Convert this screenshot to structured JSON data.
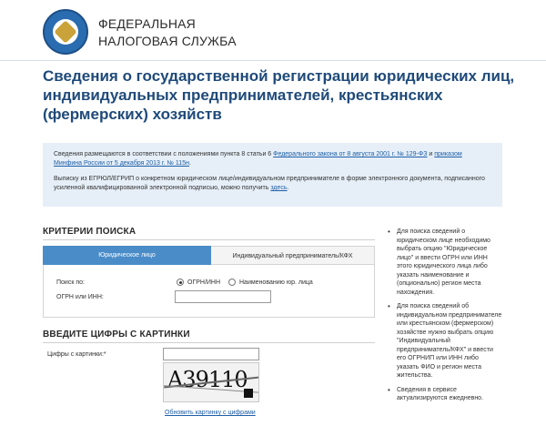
{
  "header": {
    "brand_line1": "ФЕДЕРАЛЬНАЯ",
    "brand_line2": "НАЛОГОВАЯ СЛУЖБА"
  },
  "page": {
    "title": "Сведения о государственной регистрации юридических лиц, индивидуальных предпринимателей, крестьянских (фермерских) хозяйств"
  },
  "info": {
    "p1_text": "Сведения размещаются в соответствии с положениями пункта 8 статьи 6 ",
    "p1_link1": "Федерального закона от 8 августа 2001 г. № 129-ФЗ",
    "p1_mid": " и ",
    "p1_link2": "приказом Минфина России от 5 декабря 2013 г. № 115н",
    "p1_end": ".",
    "p2_text": "Выписку из ЕГРЮЛ/ЕГРИП о конкретном юридическом лице/индивидуальном предпринимателе в форме электронного документа, подписанного усиленной квалифицированной электронной подписью, можно получить ",
    "p2_link": "здесь",
    "p2_end": "."
  },
  "search": {
    "section_title": "КРИТЕРИИ ПОИСКА",
    "tab_legal": "Юридическое лицо",
    "tab_ip": "Индивидуальный предприниматель/КФХ",
    "search_by_label": "Поиск по:",
    "option_ogrn": "ОГРН/ИНН",
    "option_name": "Наименованию юр. лица",
    "ogrn_label": "ОГРН или ИНН:",
    "ogrn_value": ""
  },
  "captcha": {
    "section_title": "ВВЕДИТЕ ЦИФРЫ С КАРТИНКИ",
    "field_label": "Цифры с картинки:*",
    "field_value": "",
    "image_text": "A39110",
    "refresh_link": "Обновить картинку с цифрами"
  },
  "sidebar": {
    "items": [
      "Для поиска сведений о юридическом лице необходимо выбрать опцию \"Юридическое лицо\" и ввести ОГРН или ИНН этого юридического лица либо указать наименование и (опционально) регион места нахождения.",
      "Для поиска сведений об индивидуальном предпринимателе или крестьянском (фермерском) хозяйстве нужно выбрать опцию \"Индивидуальный предприниматель/КФХ\" и ввести его ОГРНИП или ИНН либо указать ФИО и регион места жительства.",
      "Сведения в сервисе актуализируются ежедневно."
    ]
  },
  "colors": {
    "title": "#1f4a7a",
    "info_bg": "#e6eff8",
    "tab_active": "#4a8cc8",
    "link": "#1f5fa8"
  }
}
